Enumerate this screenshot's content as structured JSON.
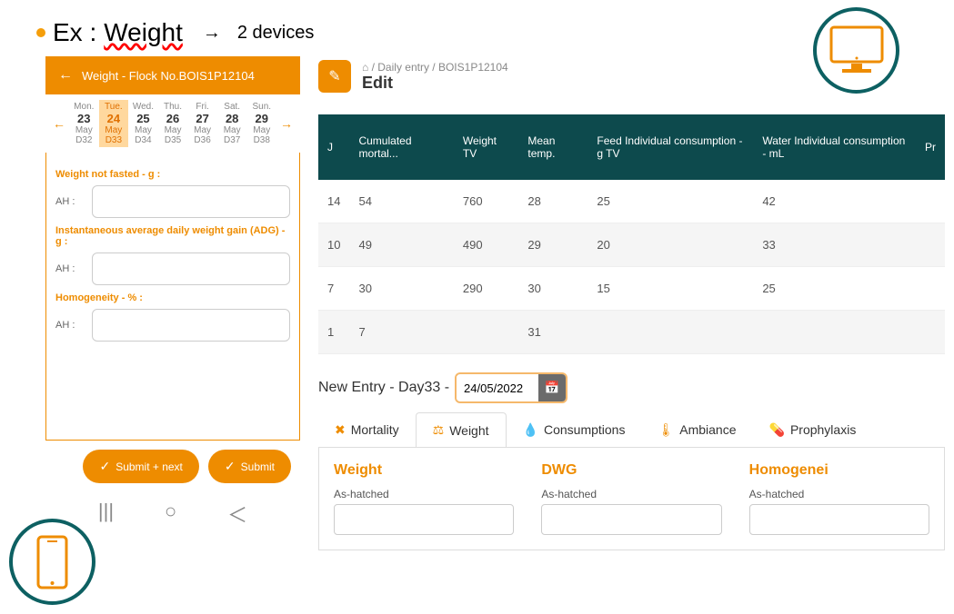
{
  "title": {
    "ex": "Ex :",
    "weight": "Weight",
    "arrow": "→",
    "devices": "2 devices"
  },
  "mobile": {
    "header": "Weight - Flock No.BOIS1P12104",
    "calendar": {
      "days": [
        {
          "dow": "Mon.",
          "num": "23",
          "mon": "May",
          "d": "D32"
        },
        {
          "dow": "Tue.",
          "num": "24",
          "mon": "May",
          "d": "D33"
        },
        {
          "dow": "Wed.",
          "num": "25",
          "mon": "May",
          "d": "D34"
        },
        {
          "dow": "Thu.",
          "num": "26",
          "mon": "May",
          "d": "D35"
        },
        {
          "dow": "Fri.",
          "num": "27",
          "mon": "May",
          "d": "D36"
        },
        {
          "dow": "Sat.",
          "num": "28",
          "mon": "May",
          "d": "D37"
        },
        {
          "dow": "Sun.",
          "num": "29",
          "mon": "May",
          "d": "D38"
        }
      ]
    },
    "form": {
      "weight_label": "Weight not fasted - g :",
      "adg_label": "Instantaneous average daily weight gain (ADG) - g :",
      "homog_label": "Homogeneity - % :",
      "ah": "AH :"
    },
    "buttons": {
      "submit_next": "Submit + next",
      "submit": "Submit"
    }
  },
  "desktop": {
    "breadcrumb": {
      "home": "⌂",
      "daily": "Daily entry",
      "flock": "BOIS1P12104"
    },
    "edit_title": "Edit",
    "table": {
      "headers": [
        "J",
        "Cumulated mortal...",
        "Weight TV",
        "Mean temp.",
        "Feed Individual consumption - g TV",
        "Water Individual consumption - mL",
        "Pr"
      ],
      "rows": [
        [
          "14",
          "54",
          "760",
          "28",
          "25",
          "42"
        ],
        [
          "10",
          "49",
          "490",
          "29",
          "20",
          "33"
        ],
        [
          "7",
          "30",
          "290",
          "30",
          "15",
          "25"
        ],
        [
          "1",
          "7",
          "",
          "31",
          "",
          ""
        ]
      ]
    },
    "new_entry": {
      "label": "New Entry - Day33 -",
      "date": "24/05/2022"
    },
    "tabs": {
      "mortality": "Mortality",
      "weight": "Weight",
      "consumptions": "Consumptions",
      "ambiance": "Ambiance",
      "prophylaxis": "Prophylaxis"
    },
    "panel": {
      "weight": "Weight",
      "dwg": "DWG",
      "homog": "Homogenei",
      "as_hatched": "As-hatched"
    }
  }
}
